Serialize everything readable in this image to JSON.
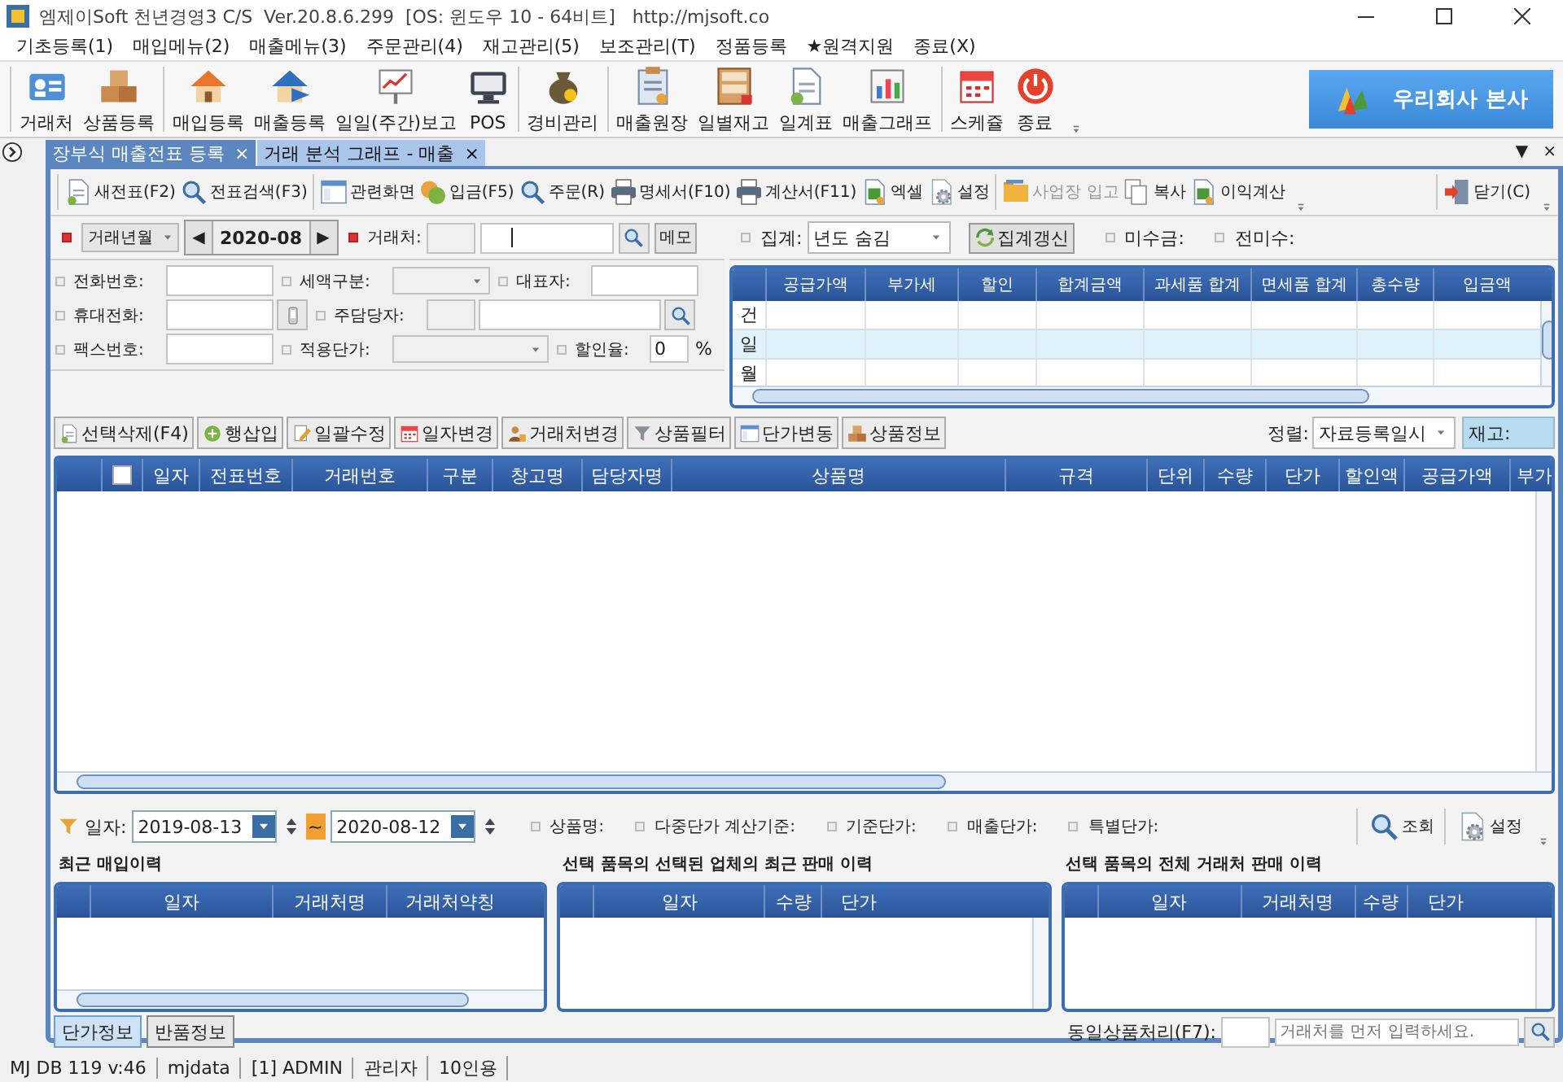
{
  "window": {
    "title": "엠제이Soft 천년경영3 C/S  Ver.20.8.6.299  [OS: 윈도우 10 - 64비트]   http://mjsoft.co"
  },
  "menu": [
    "기초등록(1)",
    "매입메뉴(2)",
    "매출메뉴(3)",
    "주문관리(4)",
    "재고관리(5)",
    "보조관리(T)",
    "정품등록",
    "★원격지원",
    "종료(X)"
  ],
  "toolbar": {
    "groups": [
      [
        {
          "label": "거래처",
          "kind": "card"
        },
        {
          "label": "상품등록",
          "kind": "boxes"
        }
      ],
      [
        {
          "label": "매입등록",
          "kind": "house"
        },
        {
          "label": "매출등록",
          "kind": "house-arrow"
        },
        {
          "label": "일일(주간)보고",
          "kind": "board"
        },
        {
          "label": "POS",
          "kind": "screen"
        }
      ],
      [
        {
          "label": "경비관리",
          "kind": "bag"
        }
      ],
      [
        {
          "label": "매출원장",
          "kind": "clipboard"
        },
        {
          "label": "일별재고",
          "kind": "shelf"
        },
        {
          "label": "일계표",
          "kind": "doc"
        },
        {
          "label": "매출그래프",
          "kind": "chart"
        }
      ],
      [
        {
          "label": "스케쥴",
          "kind": "calendar"
        },
        {
          "label": "종료",
          "kind": "power"
        }
      ]
    ],
    "company": "우리회사 본사"
  },
  "tabs": [
    {
      "label": "장부식 매출전표 등록",
      "close": "×",
      "selected": true
    },
    {
      "label": "거래 분석 그래프 - 매출",
      "close": "×",
      "selected": false
    }
  ],
  "tab_menu": "▼",
  "tab_close": "×",
  "subtoolbar": {
    "groups": [
      [
        {
          "label": "새전표(F2)",
          "kind": "doc",
          "disabled": false
        },
        {
          "label": "전표검색(F3)",
          "kind": "magnifier",
          "disabled": false
        }
      ],
      [
        {
          "label": "관련화면",
          "kind": "window",
          "disabled": false
        },
        {
          "label": "입금(F5)",
          "kind": "coin",
          "disabled": false
        },
        {
          "label": "주문(R)",
          "kind": "magnifier",
          "disabled": false
        },
        {
          "label": "명세서(F10)",
          "kind": "printer",
          "disabled": false
        },
        {
          "label": "계산서(F11)",
          "kind": "printer",
          "disabled": false
        },
        {
          "label": "엑셀",
          "kind": "excel",
          "disabled": false
        },
        {
          "label": "설정",
          "kind": "gear",
          "disabled": false
        }
      ],
      [
        {
          "label": "사업장 입고",
          "kind": "folder",
          "disabled": true
        },
        {
          "label": "복사",
          "kind": "copy",
          "disabled": false
        },
        {
          "label": "이익계산",
          "kind": "excel",
          "disabled": false
        }
      ]
    ],
    "close_button": {
      "label": "닫기(C)",
      "kind": "door"
    }
  },
  "form": {
    "period_select": "거래년월",
    "prev": "◀",
    "month": "2020-08",
    "next": "▶",
    "customer_label": "거래처:",
    "memo_button": "메모",
    "details": [
      [
        {
          "label": "전화번호:",
          "kind": "text"
        },
        {
          "label": "세액구분:",
          "kind": "select"
        },
        {
          "label": "대표자:",
          "kind": "text"
        }
      ],
      [
        {
          "label": "휴대전화:",
          "kind": "phone"
        },
        {
          "label": "주담당자:",
          "kind": "lookup"
        }
      ],
      [
        {
          "label": "팩스번호:",
          "kind": "text"
        },
        {
          "label": "적용단가:",
          "kind": "wide-select"
        },
        {
          "label": "할인율:",
          "kind": "percent",
          "value": "0",
          "unit": "%"
        }
      ]
    ]
  },
  "summary": {
    "label": "집계:",
    "select": "년도 숨김",
    "refresh_button": "집계갱신",
    "receivable_label": "미수금:",
    "prev_receivable_label": "전미수:",
    "columns": [
      "공급가액",
      "부가세",
      "할인",
      "합계금액",
      "과세품 합계",
      "면세품 합계",
      "총수량",
      "입금액"
    ],
    "row_labels": [
      "건",
      "일",
      "월"
    ]
  },
  "actions": {
    "buttons": [
      {
        "label": "선택삭제(F4)",
        "kind": "doc"
      },
      {
        "label": "행삽입",
        "kind": "plus"
      },
      {
        "label": "일괄수정",
        "kind": "pencil"
      },
      {
        "label": "일자변경",
        "kind": "calendar"
      },
      {
        "label": "거래처변경",
        "kind": "person"
      },
      {
        "label": "상품필터",
        "kind": "funnel"
      },
      {
        "label": "단가변동",
        "kind": "window"
      },
      {
        "label": "상품정보",
        "kind": "boxes"
      }
    ],
    "sort_label": "정렬:",
    "sort_select": "자료등록일시",
    "stock_label": "재고:"
  },
  "grid": {
    "header_checkbox": {
      "checked": false
    },
    "columns": [
      "일자",
      "전표번호",
      "거래번호",
      "구분",
      "창고명",
      "담당자명",
      "상품명",
      "규격",
      "단위",
      "수량",
      "단가",
      "할인액",
      "공급가액",
      "부가"
    ]
  },
  "filter": {
    "date_label": "일자:",
    "from": "2019-08-13",
    "tilde": "~",
    "to": "2020-08-12",
    "labels": [
      "상품명:",
      "다중단가 계산기준:",
      "기준단가:",
      "매출단가:",
      "특별단가:"
    ],
    "buttons": [
      {
        "label": "조회",
        "kind": "magnifier"
      },
      {
        "label": "설정",
        "kind": "gear"
      }
    ]
  },
  "history": [
    {
      "title": "최근 매입이력",
      "columns": [
        "일자",
        "거래처명",
        "거래처약칭"
      ]
    },
    {
      "title": "선택 품목의 선택된 업체의 최근 판매 이력",
      "columns": [
        "일자",
        "수량",
        "단가"
      ]
    },
    {
      "title": "선택 품목의 전체 거래처 판매 이력",
      "columns": [
        "일자",
        "거래처명",
        "수량",
        "단가"
      ]
    }
  ],
  "bottom": {
    "tabs": [
      {
        "label": "단가정보",
        "selected": true
      },
      {
        "label": "반품정보",
        "selected": false
      }
    ],
    "same_item_label": "동일상품처리(F7):",
    "placeholder": "거래처를 먼저 입력하세요."
  },
  "status_bar": [
    "MJ DB 119 v:46",
    "mjdata",
    "[1] ADMIN",
    "관리자",
    "10인용"
  ]
}
